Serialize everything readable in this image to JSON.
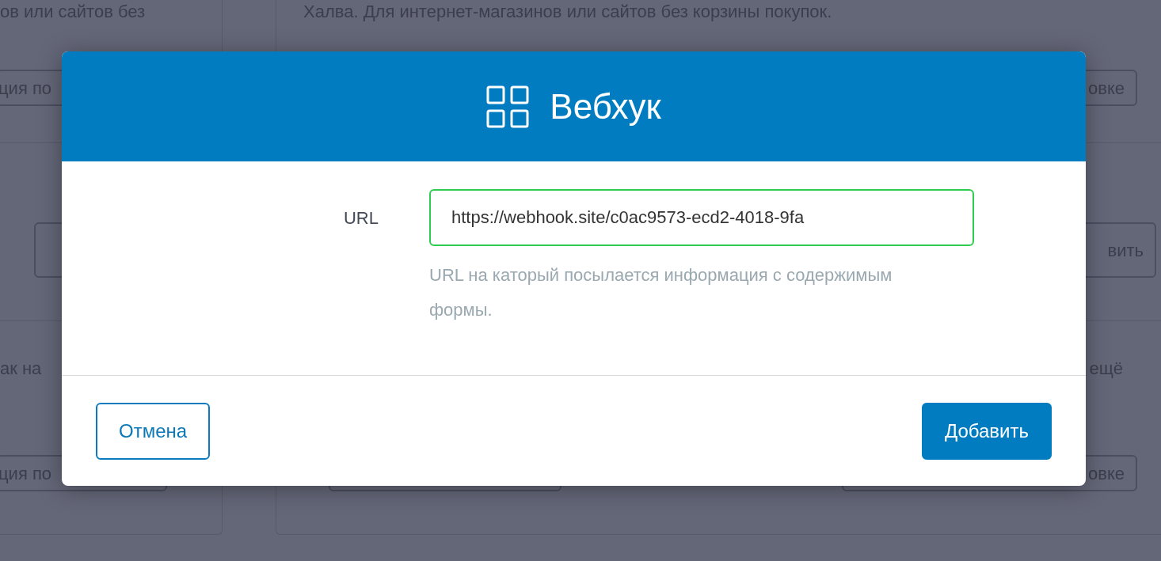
{
  "background": {
    "left_card": {
      "text_top": "ов или сайтов без",
      "button_top": "ция по",
      "text_middle": "ак на",
      "button_bottom": "ция по"
    },
    "right_card": {
      "text_top": "Халва. Для интернет-магазинов или сайтов без корзины покупок.",
      "button_top": "овке",
      "button_middle": "вить",
      "text_middle": "ещё",
      "button_bottom": "овке"
    }
  },
  "dialog": {
    "title": "Вебхук",
    "field": {
      "label": "URL",
      "value": "https://webhook.site/c0ac9573-ecd2-4018-9fa",
      "valid": true
    },
    "hint": "URL на каторый посылается информация с содержимым формы.",
    "buttons": [
      {
        "label": "Отмена",
        "kind": "secondary"
      },
      {
        "label": "Добавить",
        "kind": "primary"
      }
    ]
  }
}
